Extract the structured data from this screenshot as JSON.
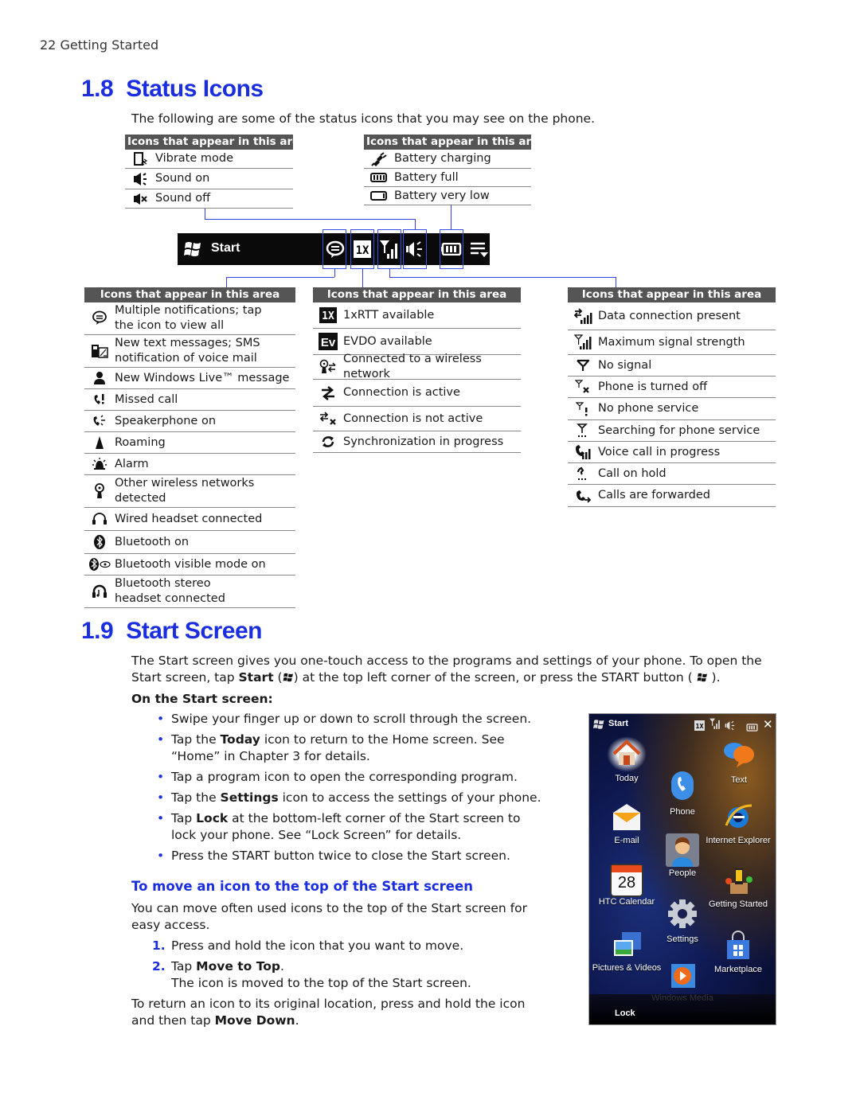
{
  "running_head": "22  Getting Started",
  "section_18": {
    "number": "1.8",
    "title": "Status Icons",
    "intro": "The following are some of the status icons that you may see on the phone.",
    "top_left_table": {
      "header": "Icons that appear in this area",
      "rows": [
        {
          "icon": "vibrate-icon",
          "label": "Vibrate mode"
        },
        {
          "icon": "sound-on-icon",
          "label": "Sound on"
        },
        {
          "icon": "sound-off-icon",
          "label": "Sound off"
        }
      ]
    },
    "top_right_table": {
      "header": "Icons that appear in this area",
      "rows": [
        {
          "icon": "battery-charging-icon",
          "label": "Battery charging"
        },
        {
          "icon": "battery-full-icon",
          "label": "Battery full"
        },
        {
          "icon": "battery-very-low-icon",
          "label": "Battery very low"
        }
      ]
    },
    "startbar": {
      "label": "Start",
      "icons": [
        "windows-flag-icon",
        "notification-bubble-icon",
        "1x-icon",
        "signal-icon",
        "speaker-icon",
        "battery-icon",
        "menu-icon"
      ]
    },
    "bottom_left_table": {
      "header": "Icons that appear in this area",
      "rows": [
        {
          "icon": "notification-bubble-icon",
          "label": "Multiple notifications; tap the icon to view all"
        },
        {
          "icon": "sms-icon",
          "label": "New text messages; SMS notification of voice mail"
        },
        {
          "icon": "windows-live-icon",
          "label": "New Windows Live™ message"
        },
        {
          "icon": "missed-call-icon",
          "label": "Missed call"
        },
        {
          "icon": "speakerphone-icon",
          "label": "Speakerphone on"
        },
        {
          "icon": "roaming-icon",
          "label": "Roaming"
        },
        {
          "icon": "alarm-icon",
          "label": "Alarm"
        },
        {
          "icon": "wireless-networks-icon",
          "label": "Other wireless networks detected"
        },
        {
          "icon": "wired-headset-icon",
          "label": "Wired headset connected"
        },
        {
          "icon": "bluetooth-icon",
          "label": "Bluetooth on"
        },
        {
          "icon": "bluetooth-visible-icon",
          "label": "Bluetooth visible mode on"
        },
        {
          "icon": "bluetooth-stereo-headset-icon",
          "label": "Bluetooth stereo headset connected"
        }
      ]
    },
    "bottom_middle_table": {
      "header": "Icons that appear in this area",
      "rows": [
        {
          "icon": "1xrtt-icon",
          "label": "1xRTT available"
        },
        {
          "icon": "evdo-icon",
          "label": "EVDO available"
        },
        {
          "icon": "wireless-connected-icon",
          "label": "Connected to a wireless network"
        },
        {
          "icon": "connection-active-icon",
          "label": "Connection is active"
        },
        {
          "icon": "connection-inactive-icon",
          "label": "Connection is not active"
        },
        {
          "icon": "sync-icon",
          "label": "Synchronization in progress"
        }
      ]
    },
    "bottom_right_table": {
      "header": "Icons that appear in this area",
      "rows": [
        {
          "icon": "data-connection-icon",
          "label": "Data connection present"
        },
        {
          "icon": "max-signal-icon",
          "label": "Maximum signal strength"
        },
        {
          "icon": "no-signal-icon",
          "label": "No signal"
        },
        {
          "icon": "phone-off-icon",
          "label": "Phone is turned off"
        },
        {
          "icon": "no-service-icon",
          "label": "No phone service"
        },
        {
          "icon": "searching-service-icon",
          "label": "Searching for phone service"
        },
        {
          "icon": "voice-call-icon",
          "label": "Voice call in progress"
        },
        {
          "icon": "call-hold-icon",
          "label": "Call on hold"
        },
        {
          "icon": "call-forward-icon",
          "label": "Calls are forwarded"
        }
      ]
    }
  },
  "section_19": {
    "number": "1.9",
    "title": "Start Screen",
    "intro_part1": "The Start screen gives you one-touch access to the programs and settings of your phone. To open the Start screen, tap ",
    "intro_bold1": "Start",
    "intro_part2": " at the top left corner of the screen, or press the START button (",
    "intro_part3": ").",
    "on_start_heading": "On the Start screen:",
    "bullets": [
      {
        "pre": "Swipe your finger up or down to scroll through the screen.",
        "bold": "",
        "post": ""
      },
      {
        "pre": "Tap the ",
        "bold": "Today",
        "post": " icon to return to the Home screen. See “Home” in Chapter 3 for details."
      },
      {
        "pre": "Tap a program icon to open the corresponding program.",
        "bold": "",
        "post": ""
      },
      {
        "pre": "Tap the ",
        "bold": "Settings",
        "post": " icon to access the settings of your phone."
      },
      {
        "pre": "Tap ",
        "bold": "Lock",
        "post": " at the bottom-left corner of the Start screen to lock your phone. See “Lock Screen” for details."
      },
      {
        "pre": "Press the START button twice to close the Start screen.",
        "bold": "",
        "post": ""
      }
    ],
    "subheading": "To move an icon to the top of the Start screen",
    "sub_intro": "You can move often used icons to the top of the Start screen for easy access.",
    "steps": [
      {
        "n": "1.",
        "pre": "Press and hold the icon that you want to move.",
        "bold": "",
        "post": "",
        "note": ""
      },
      {
        "n": "2.",
        "pre": "Tap ",
        "bold": "Move to Top",
        "post": ".",
        "note": "The icon is moved to the top of the Start screen."
      }
    ],
    "closing_pre": "To return an icon to its original location, press and hold the icon and then tap ",
    "closing_bold": "Move Down",
    "closing_post": ".",
    "phone": {
      "title": "Start",
      "tiles": [
        "Today",
        "Text",
        "Phone",
        "E-mail",
        "Internet Explorer",
        "People",
        "HTC Calendar",
        "Getting Started",
        "Settings",
        "Pictures & Videos",
        "Marketplace",
        "Windows Media"
      ],
      "calendar_day": "28",
      "lock_label": "Lock"
    }
  },
  "colors": {
    "heading_blue": "#1a2ee0",
    "table_header": "#555555",
    "connector_blue": "#3344dd"
  }
}
